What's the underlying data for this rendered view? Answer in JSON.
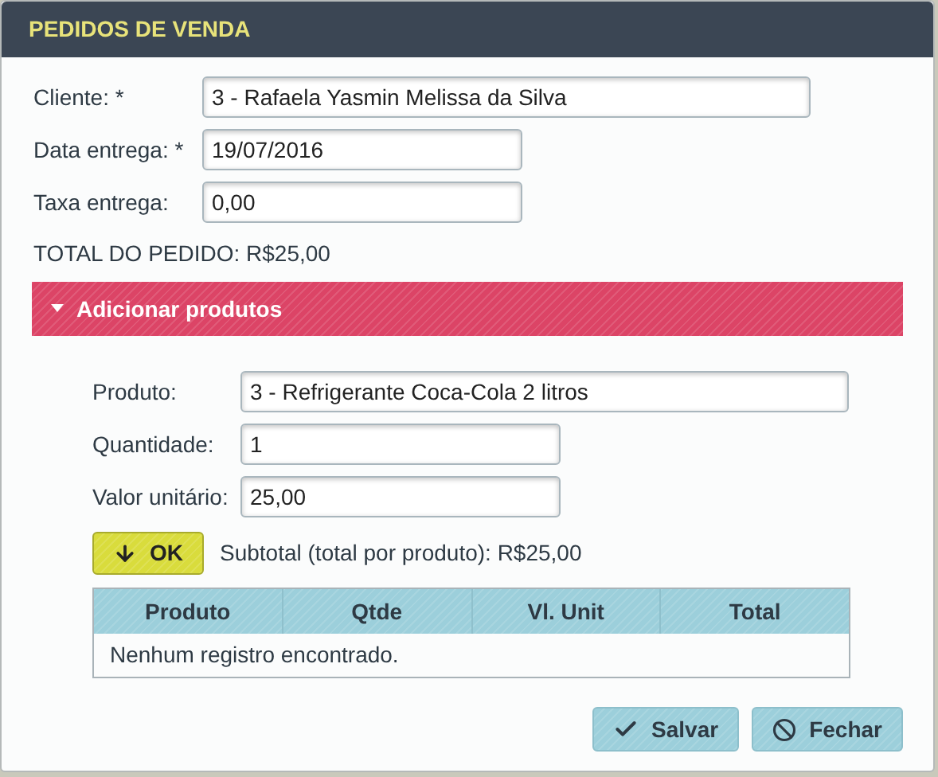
{
  "window": {
    "title": "PEDIDOS DE VENDA"
  },
  "fields": [
    {
      "label": "Cliente: *",
      "value": "3 - Rafaela Yasmin Melissa da Silva",
      "kind": "wide"
    },
    {
      "label": "Data entrega: *",
      "value": "19/07/2016",
      "kind": "short"
    },
    {
      "label": "Taxa entrega:",
      "value": "0,00",
      "kind": "short"
    }
  ],
  "total": "TOTAL DO PEDIDO: R$25,00",
  "panel": {
    "title": "Adicionar produtos",
    "expanded": true,
    "fields": [
      {
        "label": "Produto:",
        "value": "3 - Refrigerante Coca-Cola 2 litros",
        "kind": "wide"
      },
      {
        "label": "Quantidade:",
        "value": "1",
        "kind": "short"
      },
      {
        "label": "Valor unitário:",
        "value": "25,00",
        "kind": "short"
      }
    ],
    "ok_button": "OK",
    "subtotal": "Subtotal (total por produto): R$25,00",
    "table": {
      "columns": [
        "Produto",
        "Qtde",
        "Vl. Unit",
        "Total"
      ],
      "empty_message": "Nenhum registro encontrado."
    }
  },
  "buttons": [
    {
      "kind": "save",
      "label": "Salvar"
    },
    {
      "kind": "close",
      "label": "Fechar"
    }
  ]
}
